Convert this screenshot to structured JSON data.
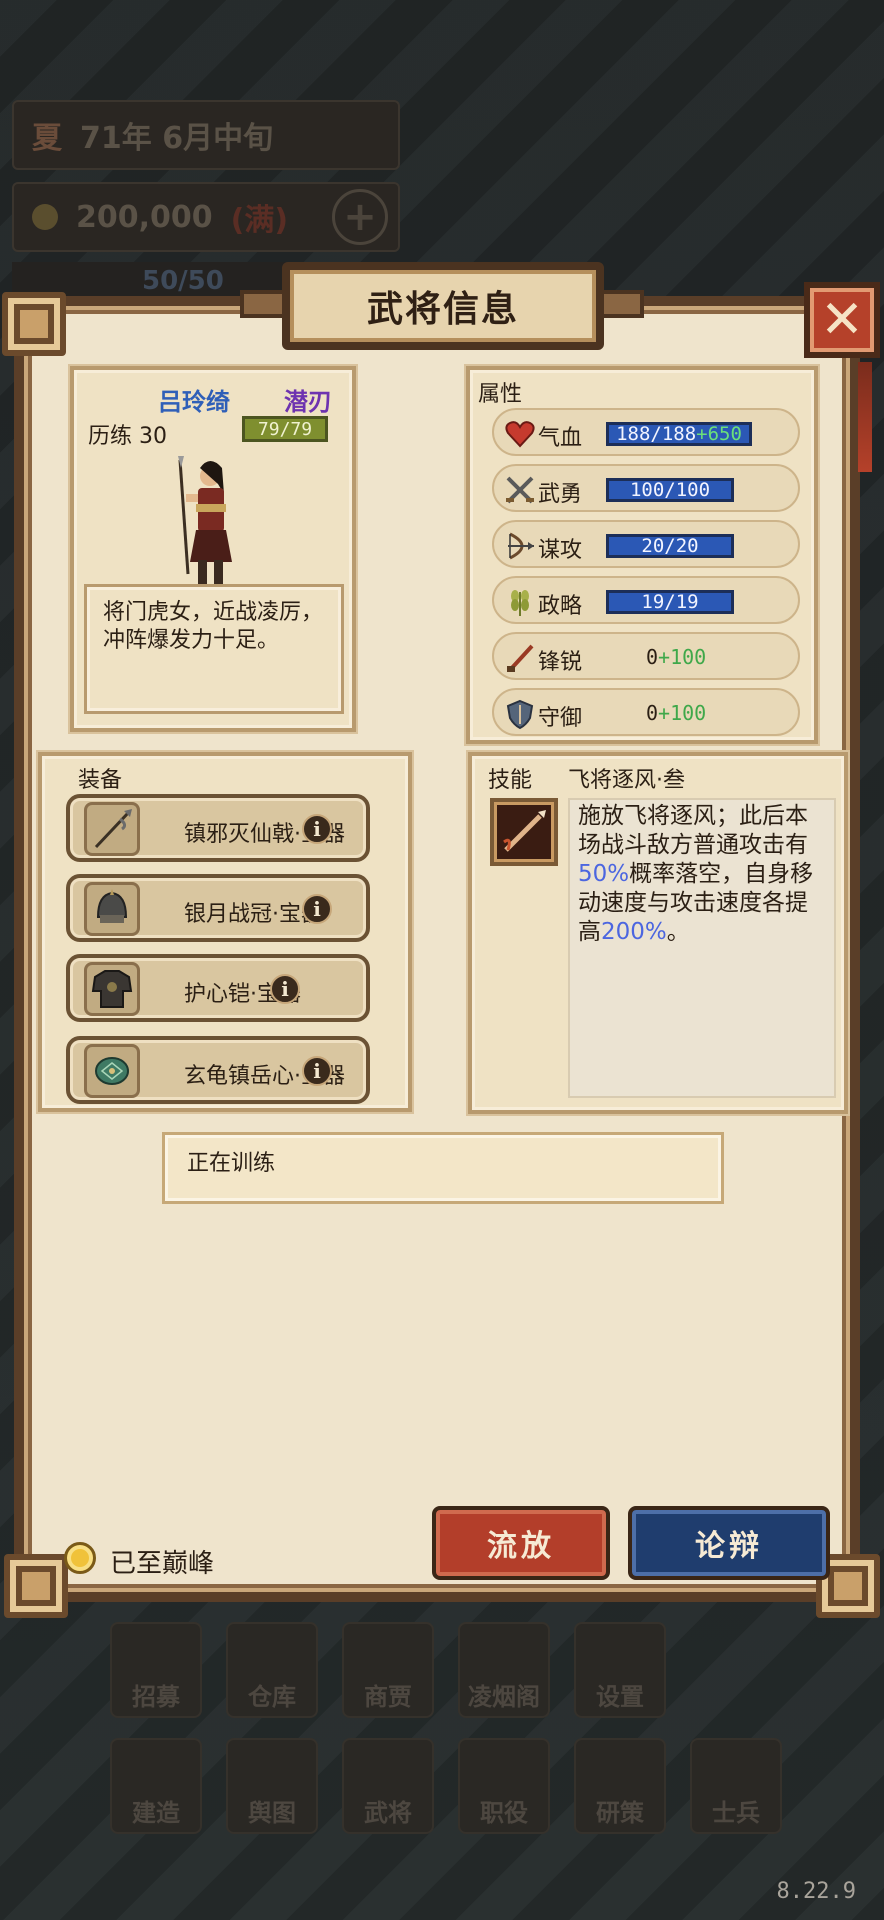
{
  "background": {
    "season": "夏",
    "date": "71年 6月中旬",
    "money": "200,000",
    "money_tag": "(满)",
    "troops": "50/50",
    "menu_row1": [
      "招募",
      "仓库",
      "商贾",
      "凌烟阁",
      "设置"
    ],
    "menu_row2": [
      "建造",
      "舆图",
      "武将",
      "职役",
      "研策",
      "士兵"
    ],
    "version": "8.22.9"
  },
  "dialog": {
    "title": "武将信息",
    "close_symbol": "✕"
  },
  "hero": {
    "name": "吕玲绮",
    "trait": "潜刃",
    "exp_label": "历练 30",
    "exp_value": "79/79",
    "description": "将门虎女，近战凌厉，冲阵爆发力十足。"
  },
  "attributes": {
    "title": "属性",
    "items": [
      {
        "name": "气血",
        "value": "188/188",
        "bonus": "+650",
        "icon": "heart-icon"
      },
      {
        "name": "武勇",
        "value": "100/100",
        "icon": "crossed-swords-icon"
      },
      {
        "name": "谋攻",
        "value": "20/20",
        "icon": "bow-icon"
      },
      {
        "name": "政略",
        "value": "19/19",
        "icon": "wheat-icon"
      },
      {
        "name": "锋锐",
        "base": "0",
        "bonus": "+100",
        "icon": "blade-icon"
      },
      {
        "name": "守御",
        "base": "0",
        "bonus": "+100",
        "icon": "shield-icon"
      }
    ]
  },
  "equipment": {
    "title": "装备",
    "items": [
      {
        "name": "镇邪灭仙戟·宝器",
        "icon": "halberd-icon"
      },
      {
        "name": "银月战冠·宝器",
        "icon": "helmet-icon"
      },
      {
        "name": "护心铠·宝器",
        "icon": "armor-icon"
      },
      {
        "name": "玄龟镇岳心·宝器",
        "icon": "turtle-gem-icon"
      }
    ]
  },
  "skill": {
    "label": "技能",
    "name": "飞将逐风·叁",
    "desc_part1": "施放飞将逐风；此后本场战斗敌方普通攻击有",
    "desc_pct1": "50%",
    "desc_part2": "概率落空，自身移动速度与攻击速度各提高",
    "desc_pct2": "200%",
    "desc_part3": "。"
  },
  "status": {
    "text": "正在训练"
  },
  "footer": {
    "peak_text": "已至巅峰",
    "exile_label": "流放",
    "debate_label": "论辩"
  },
  "colors": {
    "accent_red": "#b33e2a",
    "accent_blue": "#1f3d6e",
    "bar_blue": "#2b58b5",
    "exp_green": "#7f8f2f",
    "name_blue": "#2f5fb8",
    "trait_purple": "#6e33b0"
  }
}
